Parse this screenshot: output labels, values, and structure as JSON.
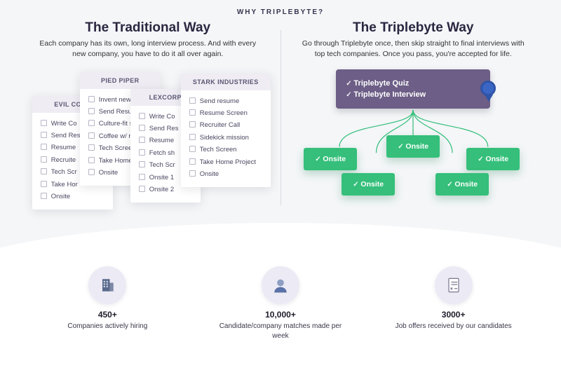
{
  "heading": "WHY TRIPLEBYTE?",
  "left": {
    "title": "The Traditional Way",
    "subtitle": "Each company has its own, long interview process. And with every new company, you have to do it all over again.",
    "cards": [
      {
        "name": "EVIL CORP",
        "steps": [
          "Write Co",
          "Send Res",
          "Resume",
          "Recruite",
          "Tech Scr",
          "Take Hor",
          "Onsite"
        ]
      },
      {
        "name": "PIED PIPER",
        "steps": [
          "Invent new",
          "Send Resun",
          "Culture-fit s",
          "Coffee w/ r",
          "Tech Screer",
          "Take Home",
          "Onsite"
        ]
      },
      {
        "name": "LEXCORP",
        "steps": [
          "Write Co",
          "Send Res",
          "Resume",
          "Fetch sh",
          "Tech Scr",
          "Onsite 1",
          "Onsite 2"
        ]
      },
      {
        "name": "STARK INDUSTRIES",
        "steps": [
          "Send resume",
          "Resume Screen",
          "Recruiter Call",
          "Sidekick mission",
          "Tech Screen",
          "Take Home Project",
          "Onsite"
        ]
      }
    ]
  },
  "right": {
    "title": "The Triplebyte Way",
    "subtitle": "Go through Triplebyte once, then skip straight to final interviews with top tech companies. Once you pass, you're accepted for life.",
    "steps": [
      "Triplebyte Quiz",
      "Triplebyte Interview"
    ],
    "onsite_label": "Onsite",
    "onsite_count": 5
  },
  "stats": [
    {
      "value": "450+",
      "label": "Companies actively hiring",
      "icon": "building-icon"
    },
    {
      "value": "10,000+",
      "label": "Candidate/company matches made per week",
      "icon": "person-icon"
    },
    {
      "value": "3000+",
      "label": "Job offers received by our candidates",
      "icon": "document-icon"
    }
  ],
  "colors": {
    "accent_purple": "#6c5e86",
    "accent_green": "#35bf7a"
  }
}
